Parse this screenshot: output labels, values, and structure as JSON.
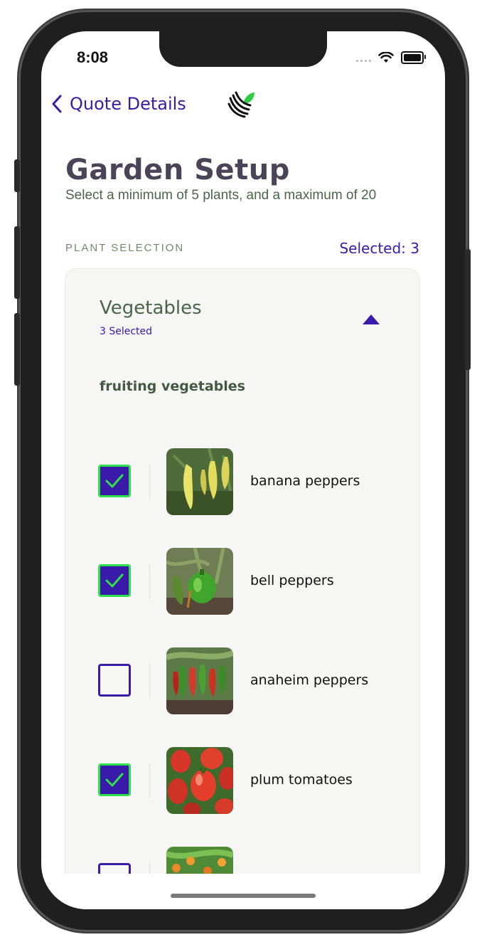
{
  "status_bar": {
    "time": "8:08"
  },
  "nav": {
    "back_label": "Quote Details",
    "logo_icon": "leaf-logo-icon"
  },
  "header": {
    "title": "Garden Setup",
    "subtitle": "Select a minimum of 5 plants, and a maximum of 20"
  },
  "selection": {
    "section_label": "PLANT SELECTION",
    "selected_count": "Selected: 3"
  },
  "category": {
    "title": "Vegetables",
    "selected_text": "3 Selected",
    "group_title": "fruiting vegetables",
    "plants": [
      {
        "name": "banana peppers",
        "checked": true
      },
      {
        "name": "bell peppers",
        "checked": true
      },
      {
        "name": "anaheim peppers",
        "checked": false
      },
      {
        "name": "plum tomatoes",
        "checked": true
      },
      {
        "name": "",
        "checked": false
      }
    ]
  },
  "colors": {
    "accent": "#3a1aa8",
    "check_border": "#2ee04c",
    "green_text": "#4a6648"
  }
}
